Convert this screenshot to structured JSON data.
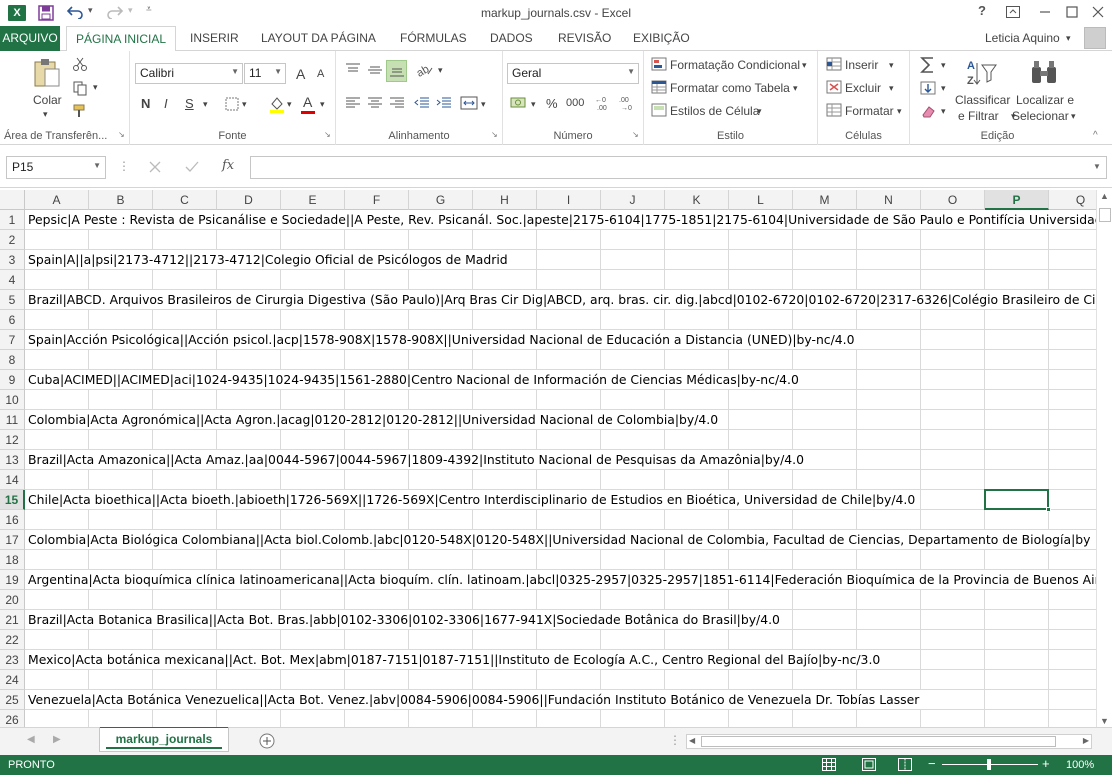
{
  "app": {
    "title": "markup_journals.csv - Excel",
    "logo": "X",
    "user": "Leticia Aquino",
    "help": "?"
  },
  "tabs": [
    "ARQUIVO",
    "PÁGINA INICIAL",
    "INSERIR",
    "LAYOUT DA PÁGINA",
    "FÓRMULAS",
    "DADOS",
    "REVISÃO",
    "EXIBIÇÃO"
  ],
  "ribbon": {
    "clipboard": {
      "paste": "Colar",
      "label": "Área de Transferên..."
    },
    "font": {
      "name": "Calibri",
      "size": "11",
      "bold": "N",
      "italic": "I",
      "underline": "S",
      "grow": "A",
      "shrink": "A",
      "color_letter": "A",
      "label": "Fonte"
    },
    "alignment": {
      "label": "Alinhamento"
    },
    "number": {
      "format": "Geral",
      "label": "Número",
      "percent": "%",
      "thousands": "000"
    },
    "styles": {
      "conditional": "Formatação Condicional",
      "table": "Formatar como Tabela",
      "cell": "Estilos de Célula",
      "label": "Estilo"
    },
    "cells": {
      "insert": "Inserir",
      "delete": "Excluir",
      "format": "Formatar",
      "label": "Células"
    },
    "editing": {
      "sort1": "Classificar",
      "sort2": "e Filtrar",
      "find1": "Localizar e",
      "find2": "Selecionar",
      "label": "Edição"
    }
  },
  "formula_bar": {
    "name_box": "P15",
    "fx": "fx",
    "value": ""
  },
  "columns": [
    "A",
    "B",
    "C",
    "D",
    "E",
    "F",
    "G",
    "H",
    "I",
    "J",
    "K",
    "L",
    "M",
    "N",
    "O",
    "P",
    "Q"
  ],
  "rows": [
    "1",
    "2",
    "3",
    "4",
    "5",
    "6",
    "7",
    "8",
    "9",
    "10",
    "11",
    "12",
    "13",
    "14",
    "15",
    "16",
    "17",
    "18",
    "19",
    "20",
    "21",
    "22",
    "23",
    "24",
    "25",
    "26"
  ],
  "active_cell": "P15",
  "cells": [
    "Pepsic|A Peste : Revista de Psicanálise e Sociedade||A Peste, Rev. Psicanál. Soc.|apeste|2175-6104|1775-1851|2175-6104|Universidade de São Paulo e Pontifícia Universidade",
    "",
    "Spain|A||a|psi|2173-4712||2173-4712|Colegio Oficial de Psicólogos de Madrid",
    "",
    "Brazil|ABCD. Arquivos Brasileiros de Cirurgia Digestiva (São Paulo)|Arq Bras Cir Dig|ABCD, arq. bras. cir. dig.|abcd|0102-6720|0102-6720|2317-6326|Colégio Brasileiro de Cirurgia",
    "",
    "Spain|Acción Psicológica||Acción psicol.|acp|1578-908X|1578-908X||Universidad Nacional de Educación a Distancia (UNED)|by-nc/4.0",
    "",
    "Cuba|ACIMED||ACIMED|aci|1024-9435|1024-9435|1561-2880|Centro Nacional de Información de Ciencias Médicas|by-nc/4.0",
    "",
    "Colombia|Acta Agronómica||Acta Agron.|acag|0120-2812|0120-2812||Universidad Nacional de Colombia|by/4.0",
    "",
    "Brazil|Acta Amazonica||Acta Amaz.|aa|0044-5967|0044-5967|1809-4392|Instituto Nacional de Pesquisas da Amazônia|by/4.0",
    "",
    "Chile|Acta bioethica||Acta bioeth.|abioeth|1726-569X||1726-569X|Centro Interdisciplinario de Estudios en Bioética, Universidad de Chile|by/4.0",
    "",
    "Colombia|Acta Biológica Colombiana||Acta biol.Colomb.|abc|0120-548X|0120-548X||Universidad Nacional de Colombia, Facultad de Ciencias, Departamento de Biología|by",
    "",
    "Argentina|Acta bioquímica clínica latinoamericana||Acta bioquím. clín. latinoam.|abcl|0325-2957|0325-2957|1851-6114|Federación Bioquímica de la Provincia de Buenos Aires",
    "",
    "Brazil|Acta Botanica Brasilica||Acta Bot. Bras.|abb|0102-3306|0102-3306|1677-941X|Sociedade Botânica do Brasil|by/4.0",
    "",
    "Mexico|Acta botánica mexicana||Act. Bot. Mex|abm|0187-7151|0187-7151||Instituto de Ecología A.C., Centro Regional del Bajío|by-nc/3.0",
    "",
    "Venezuela|Acta Botánica Venezuelica||Acta Bot. Venez.|abv|0084-5906|0084-5906||Fundación Instituto Botánico de Venezuela Dr. Tobías Lasser",
    ""
  ],
  "sheet_tab": "markup_journals",
  "status": {
    "text": "PRONTO",
    "zoom": "100%"
  },
  "icons": [
    "excel-logo-icon",
    "save-icon",
    "undo-icon",
    "redo-icon",
    "customize-qat-icon",
    "help-icon",
    "ribbon-display-icon",
    "minimize-icon",
    "maximize-icon",
    "close-icon",
    "paste-icon",
    "cut-icon",
    "copy-icon",
    "format-painter-icon",
    "sum-icon",
    "fill-icon",
    "clear-icon",
    "sort-filter-icon",
    "find-select-icon",
    "plus-icon"
  ],
  "colors": {
    "accent": "#217346",
    "grid": "#dadada",
    "header_bg": "#f3f3f3"
  }
}
